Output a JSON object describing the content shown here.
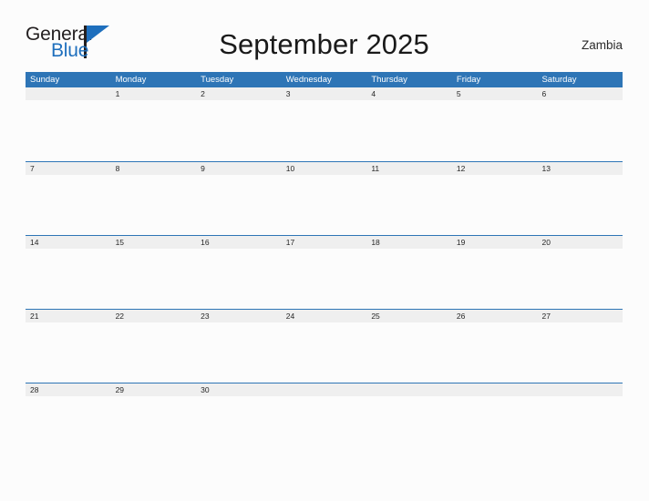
{
  "brand": {
    "name_part1": "General",
    "name_part2": "Blue",
    "flag_icon": "triangle-flag-icon",
    "accent_color": "#1e6fbd"
  },
  "header": {
    "title": "September 2025",
    "locale": "Zambia"
  },
  "theme": {
    "header_blue": "#2e75b6",
    "band_gray": "#efefef",
    "page_background": "#fcfcfc",
    "text_dark": "#262626"
  },
  "calendar": {
    "month": "September",
    "year": "2025",
    "weekdays": [
      "Sunday",
      "Monday",
      "Tuesday",
      "Wednesday",
      "Thursday",
      "Friday",
      "Saturday"
    ],
    "weeks": [
      [
        "",
        "1",
        "2",
        "3",
        "4",
        "5",
        "6"
      ],
      [
        "7",
        "8",
        "9",
        "10",
        "11",
        "12",
        "13"
      ],
      [
        "14",
        "15",
        "16",
        "17",
        "18",
        "19",
        "20"
      ],
      [
        "21",
        "22",
        "23",
        "24",
        "25",
        "26",
        "27"
      ],
      [
        "28",
        "29",
        "30",
        "",
        "",
        "",
        ""
      ]
    ]
  }
}
